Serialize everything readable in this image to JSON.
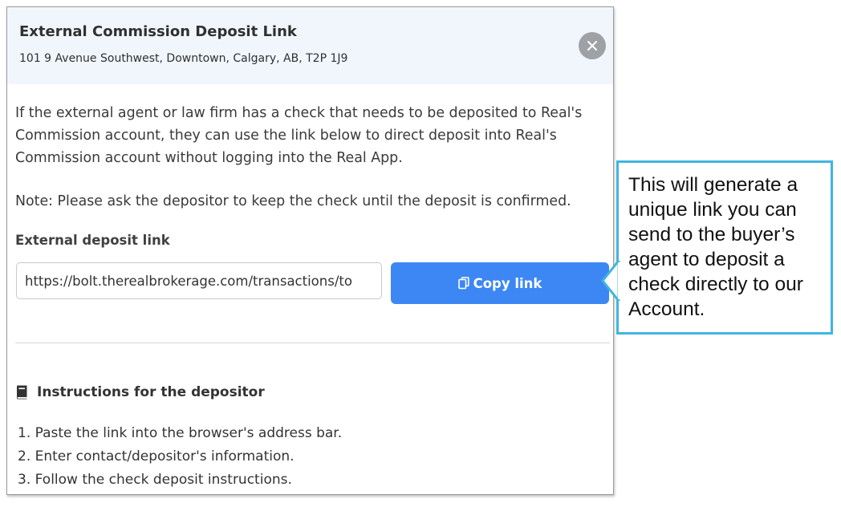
{
  "modal": {
    "title": "External Commission Deposit Link",
    "address": "101 9 Avenue Southwest, Downtown, Calgary, AB, T2P 1J9",
    "close_icon": "close-icon"
  },
  "body": {
    "paragraph1": "If the external agent or law firm has a check that needs to be deposited to Real's Commission account, they can use the link below to direct deposit into Real's Commission account without logging into the Real App.",
    "note": "Note: Please ask the depositor to keep the check until the deposit is confirmed."
  },
  "deposit_link": {
    "label": "External deposit link",
    "value": "https://bolt.therealbrokerage.com/transactions/to",
    "copy_label": "Copy link",
    "copy_icon": "copy-icon"
  },
  "instructions": {
    "title": "Instructions for the depositor",
    "icon": "book-icon",
    "steps": [
      "1. Paste the link into the browser's address bar.",
      "2. Enter contact/depositor's information.",
      "3. Follow the check deposit instructions."
    ]
  },
  "callout": {
    "text": "This will generate a unique link you can send to the buyer’s agent to deposit a check directly to our Account."
  },
  "colors": {
    "header_bg": "#f1f6fc",
    "accent": "#3d87f5",
    "callout_border": "#3fb6e0",
    "close_bg": "#9ea1a6"
  }
}
